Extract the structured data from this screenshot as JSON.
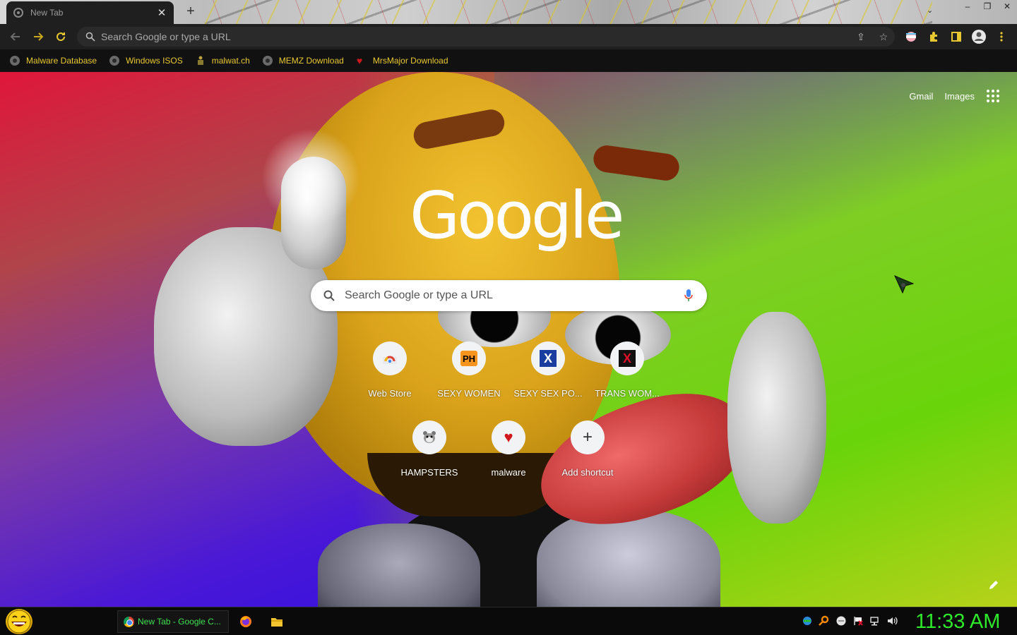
{
  "browser": {
    "tab": {
      "title": "New Tab",
      "close": "✕"
    },
    "new_tab": "+",
    "window_controls": [
      "‒",
      "❐",
      "✕"
    ],
    "omnibox": {
      "placeholder": "Search Google or type a URL"
    },
    "accent_color": "#e8c830"
  },
  "bookmarks": [
    {
      "label": "Malware Database",
      "icon": "globe-icon"
    },
    {
      "label": "Windows ISOS",
      "icon": "globe-icon"
    },
    {
      "label": "malwat.ch",
      "icon": "figure-icon"
    },
    {
      "label": "MEMZ Download",
      "icon": "globe-icon"
    },
    {
      "label": "MrsMajor Download",
      "icon": "heart-icon"
    }
  ],
  "ntp": {
    "links": {
      "gmail": "Gmail",
      "images": "Images"
    },
    "logo": "Google",
    "search_placeholder": "Search Google or type a URL",
    "shortcuts": [
      {
        "label": "Web Store",
        "icon": "webstore-icon"
      },
      {
        "label": "SEXY WOMEN",
        "icon": "ph-icon",
        "glyph": "PH"
      },
      {
        "label": "SEXY SEX PO...",
        "icon": "x-blue-icon",
        "glyph": "X"
      },
      {
        "label": "TRANS WOM...",
        "icon": "x-red-icon",
        "glyph": "X"
      },
      {
        "label": "HAMPSTERS",
        "icon": "hamster-icon"
      },
      {
        "label": "malware",
        "icon": "heart-icon",
        "glyph": "♥"
      },
      {
        "label": "Add shortcut",
        "icon": "plus-icon",
        "glyph": "+"
      }
    ]
  },
  "taskbar": {
    "task_label": "New Tab - Google C...",
    "clock": "11:33 AM",
    "clock_color": "#2ee82a"
  }
}
